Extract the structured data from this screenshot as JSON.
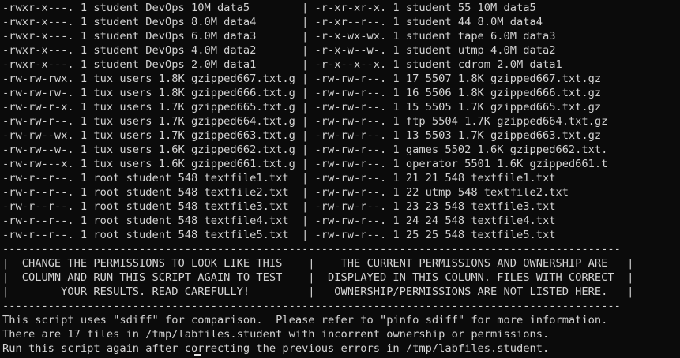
{
  "terminal": {
    "lines": [
      "-rwxr-x---. 1 student DevOps 10M data5        | -r-xr-xr-x. 1 student 55 10M data5",
      "-rwxr-x---. 1 student DevOps 8.0M data4       | -r-xr--r--. 1 student 44 8.0M data4",
      "-rwxr-x---. 1 student DevOps 6.0M data3       | -r-x-wx-wx. 1 student tape 6.0M data3",
      "-rwxr-x---. 1 student DevOps 4.0M data2       | -r-x-w--w-. 1 student utmp 4.0M data2",
      "-rwxr-x---. 1 student DevOps 2.0M data1       | -r-x--x--x. 1 student cdrom 2.0M data1",
      "-rw-rw-rwx. 1 tux users 1.8K gzipped667.txt.g | -rw-rw-r--. 1 17 5507 1.8K gzipped667.txt.gz",
      "-rw-rw-rw-. 1 tux users 1.8K gzipped666.txt.g | -rw-rw-r--. 1 16 5506 1.8K gzipped666.txt.gz",
      "-rw-rw-r-x. 1 tux users 1.7K gzipped665.txt.g | -rw-rw-r--. 1 15 5505 1.7K gzipped665.txt.gz",
      "-rw-rw-r--. 1 tux users 1.7K gzipped664.txt.g | -rw-rw-r--. 1 ftp 5504 1.7K gzipped664.txt.gz",
      "-rw-rw--wx. 1 tux users 1.7K gzipped663.txt.g | -rw-rw-r--. 1 13 5503 1.7K gzipped663.txt.gz",
      "-rw-rw--w-. 1 tux users 1.6K gzipped662.txt.g | -rw-rw-r--. 1 games 5502 1.6K gzipped662.txt.",
      "-rw-rw---x. 1 tux users 1.6K gzipped661.txt.g | -rw-rw-r--. 1 operator 5501 1.6K gzipped661.t",
      "-rw-r--r--. 1 root student 548 textfile1.txt  | -rw-rw-r--. 1 21 21 548 textfile1.txt",
      "-rw-r--r--. 1 root student 548 textfile2.txt  | -rw-rw-r--. 1 22 utmp 548 textfile2.txt",
      "-rw-r--r--. 1 root student 548 textfile3.txt  | -rw-rw-r--. 1 23 23 548 textfile3.txt",
      "-rw-r--r--. 1 root student 548 textfile4.txt  | -rw-rw-r--. 1 24 24 548 textfile4.txt",
      "-rw-r--r--. 1 root student 548 textfile5.txt  | -rw-rw-r--. 1 25 25 548 textfile5.txt",
      "-----------------------------------------------------------------------------------------------",
      "|  CHANGE THE PERMISSIONS TO LOOK LIKE THIS    |    THE CURRENT PERMISSIONS AND OWNERSHIP ARE   |",
      "|  COLUMN AND RUN THIS SCRIPT AGAIN TO TEST    |  DISPLAYED IN THIS COLUMN. FILES WITH CORRECT  |",
      "|        YOUR RESULTS. READ CAREFULLY!         |   OWNERSHIP/PERMISSIONS ARE NOT LISTED HERE.   |",
      "-----------------------------------------------------------------------------------------------",
      "This script uses \"sdiff\" for comparison.  Please refer to \"pinfo sdiff\" for more information.",
      "There are 17 files in /tmp/labfiles.student with incorrent ownership or permissions.",
      "Run this script again after correcting the previous errors in /tmp/labfiles.student."
    ]
  },
  "colors": {
    "background": "#0b0b0b",
    "foreground": "#d3d3d3",
    "cursor": "#e6e6e6"
  }
}
